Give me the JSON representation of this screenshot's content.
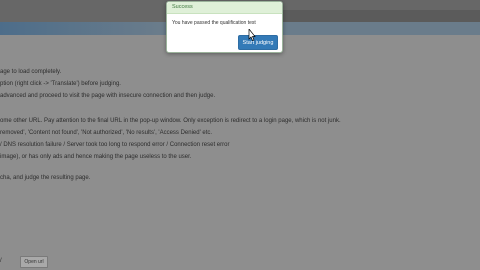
{
  "content": {
    "lines": [
      "age to load completely.",
      "ption (right click -> 'Translate') before judging.",
      "advanced and proceed to visit the page with insecure connection and then judge.",
      "ome other URL. Pay attention to the final URL in the pop-up window. Only exception is redirect to a login page, which is not junk.",
      "removed', 'Content not found', 'Not authorized', 'No results', 'Access Denied' etc.",
      "/ DNS resolution failure / Server took too long to respond error / Connection reset error",
      "image), or has only ads and hence making the page useless to the user.",
      "cha, and judge the resulting page."
    ]
  },
  "footer": {
    "url_label": "/",
    "open_url_button": "Open url"
  },
  "modal": {
    "title": "Success",
    "message": "You have passed the qualification test",
    "button_label": "Start judging",
    "colors": {
      "header_bg": "#dff0d8",
      "header_text": "#3c763d",
      "button_bg": "#337ab7"
    }
  }
}
